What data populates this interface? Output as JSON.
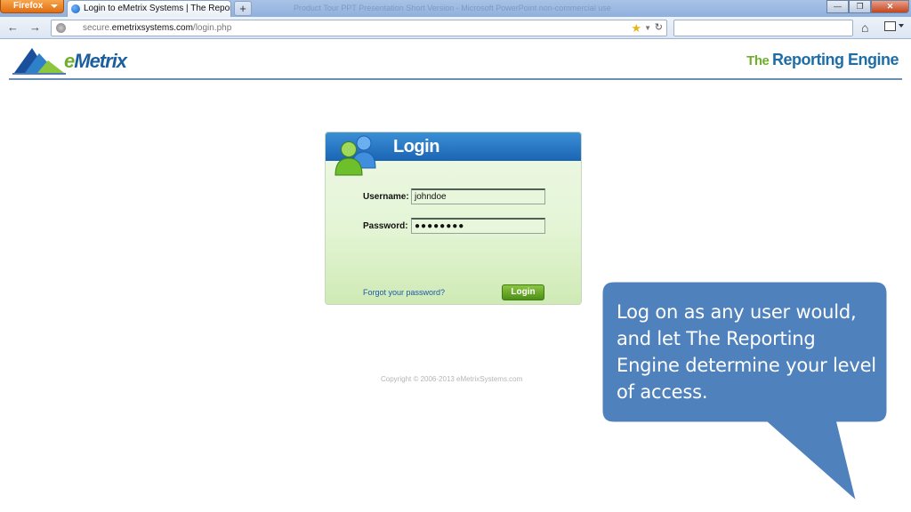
{
  "browser": {
    "menu_label": "Firefox",
    "tab_title": "Login to eMetrix Systems | The Reportin...",
    "new_tab_label": "+",
    "window_title": "Product Tour PPT Presentation Short Version - Microsoft PowerPoint non-commercial use",
    "url_prefix": "secure.",
    "url_domain": "emetrixsystems.com",
    "url_path": "/login.php",
    "back_label": "←",
    "forward_label": "→"
  },
  "header": {
    "brand_logo_prefix": "e",
    "brand_logo_rest": "Metrix",
    "product_logo_prefix": "The ",
    "product_logo_rest": "Reporting Engine"
  },
  "login": {
    "title": "Login",
    "username_label": "Username:",
    "username_value": "johndoe",
    "password_label": "Password:",
    "password_value": "●●●●●●●●",
    "forgot_link": "Forgot your password?",
    "submit_label": "Login"
  },
  "footer": {
    "copyright": "Copyright © 2006-2013 eMetrixSystems.com"
  },
  "callout": {
    "text": "Log on as any user would, and let The Reporting Engine determine your level of access.",
    "fill_color": "#4f81bd"
  }
}
